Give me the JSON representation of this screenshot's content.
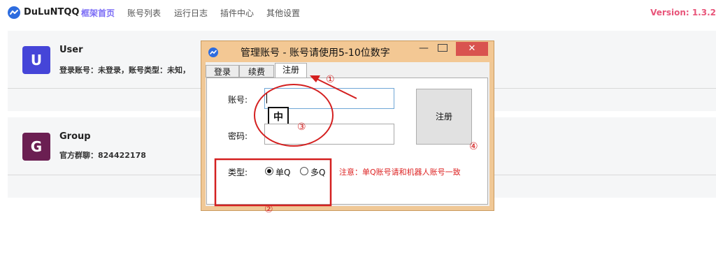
{
  "app": {
    "name": "DuLuNTQQ",
    "version": "Version: 1.3.2",
    "brand_color": "#2d6cdf",
    "accent_color": "#7b6cf6",
    "version_color": "#e8557a"
  },
  "nav": {
    "items": [
      {
        "label": "框架首页",
        "active": true
      },
      {
        "label": "账号列表",
        "active": false
      },
      {
        "label": "运行日志",
        "active": false
      },
      {
        "label": "插件中心",
        "active": false
      },
      {
        "label": "其他设置",
        "active": false
      }
    ]
  },
  "user_card": {
    "avatar_letter": "U",
    "avatar_color": "#4545d8",
    "title": "User",
    "subtitle": "登录账号：未登录，账号类型：未知，"
  },
  "group_card": {
    "avatar_letter": "G",
    "avatar_color": "#6b1f52",
    "title": "Group",
    "subtitle": "官方群聊：824422178"
  },
  "dialog": {
    "title": "管理账号 - 账号请使用5-10位数字",
    "min_glyph": "—",
    "close_glyph": "✕",
    "tabs": [
      {
        "label": "登录",
        "active": false
      },
      {
        "label": "续费",
        "active": false
      },
      {
        "label": "注册",
        "active": true
      }
    ],
    "account_label": "账号:",
    "account_value": "",
    "password_label": "密码:",
    "password_value": "",
    "ime_indicator": "中",
    "register_button": "注册",
    "type_label": "类型:",
    "type_options": [
      {
        "label": "单Q",
        "checked": true
      },
      {
        "label": "多Q",
        "checked": false
      }
    ],
    "note": "注意：单Q账号请和机器人账号一致"
  },
  "annotations": {
    "color": "#d42020",
    "markers": [
      "①",
      "②",
      "③",
      "④"
    ]
  }
}
